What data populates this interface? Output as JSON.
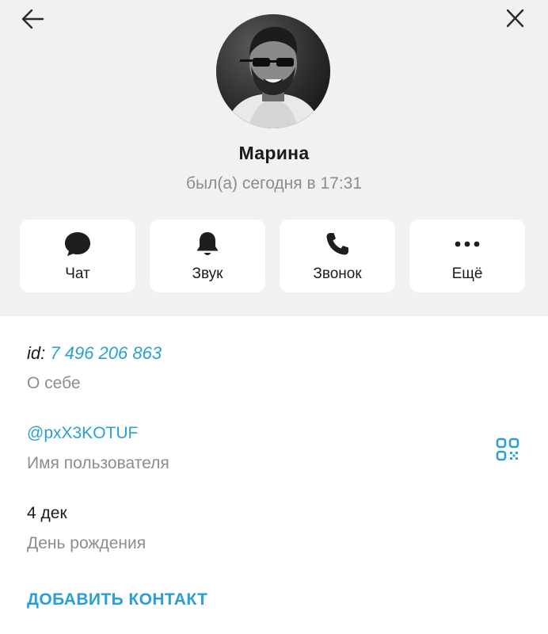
{
  "profile": {
    "name": "Марина",
    "status": "был(а) сегодня в 17:31"
  },
  "header": {
    "back_icon": "arrow-left-icon",
    "close_icon": "close-icon"
  },
  "actions": [
    {
      "label": "Чат",
      "icon": "chat-bubble-icon"
    },
    {
      "label": "Звук",
      "icon": "bell-icon"
    },
    {
      "label": "Звонок",
      "icon": "phone-icon"
    },
    {
      "label": "Ещё",
      "icon": "more-dots-icon"
    }
  ],
  "info": {
    "id_prefix": "id:",
    "id_value": "7 496 206 863",
    "id_label": "О себе",
    "username": "@pxX3KOTUF",
    "username_label": "Имя пользователя",
    "birthday": "4 дек",
    "birthday_label": "День рождения"
  },
  "add_contact_label": "ДОБАВИТЬ КОНТАКТ",
  "colors": {
    "accent": "#2c9fd1",
    "header_bg": "#f1f1f1",
    "muted_text": "#8c8c8c"
  }
}
